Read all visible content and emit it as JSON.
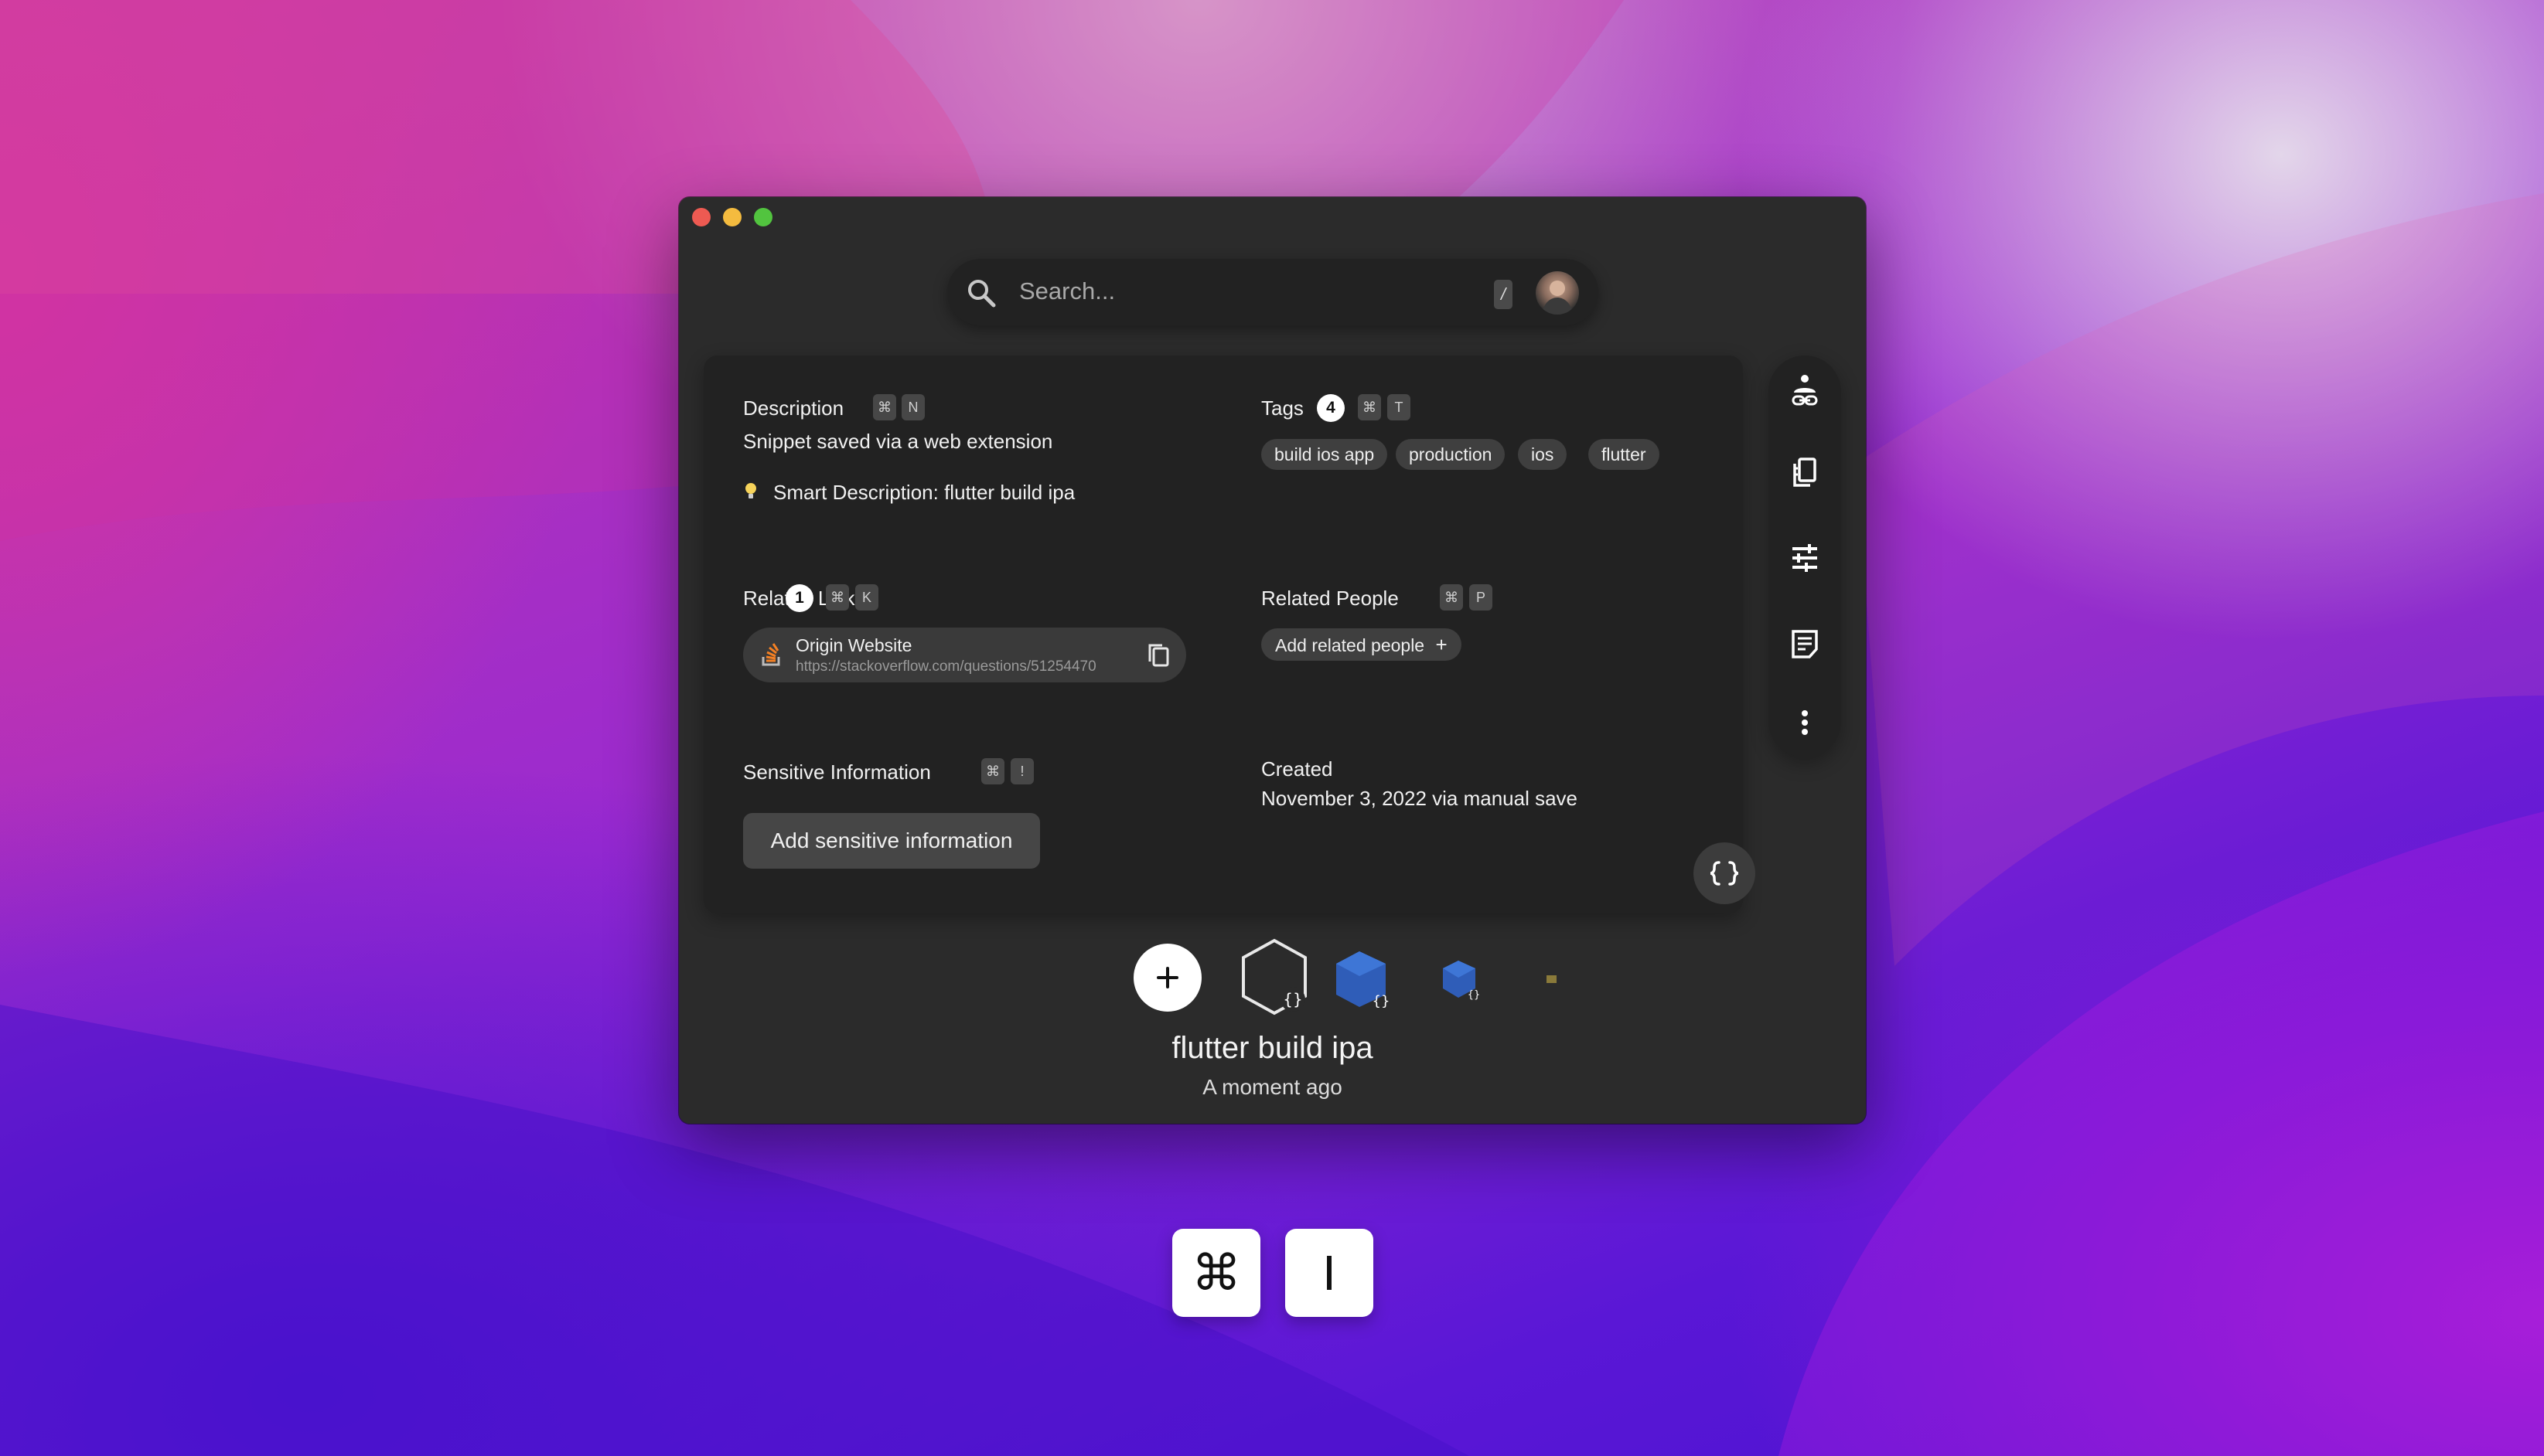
{
  "search": {
    "placeholder": "Search...",
    "shortcut": "/"
  },
  "description": {
    "label": "Description",
    "keys": [
      "⌘",
      "N"
    ],
    "text": "Snippet saved via a web extension",
    "smart": "Smart Description: flutter build ipa"
  },
  "tags": {
    "label": "Tags",
    "count": "4",
    "keys": [
      "⌘",
      "T"
    ],
    "items": [
      "build ios app",
      "production",
      "ios",
      "flutter"
    ]
  },
  "related_links": {
    "label": "Related Links",
    "count": "1",
    "keys": [
      "⌘",
      "K"
    ],
    "link": {
      "title": "Origin Website",
      "url": "https://stackoverflow.com/questions/51254470"
    }
  },
  "related_people": {
    "label": "Related People",
    "keys": [
      "⌘",
      "P"
    ],
    "button": "Add related people",
    "button_icon": "+"
  },
  "sensitive": {
    "label": "Sensitive Information",
    "keys": [
      "⌘",
      "!"
    ],
    "button": "Add sensitive information"
  },
  "created": {
    "label": "Created",
    "value": "November 3, 2022 via manual save"
  },
  "rail_icons": [
    "person-link-icon",
    "copy-page-icon",
    "sliders-icon",
    "note-icon",
    "more-vertical-icon"
  ],
  "snippet": {
    "title": "flutter build ipa",
    "time": "A moment ago"
  },
  "shortcut_keys": [
    "⌘",
    "I"
  ]
}
